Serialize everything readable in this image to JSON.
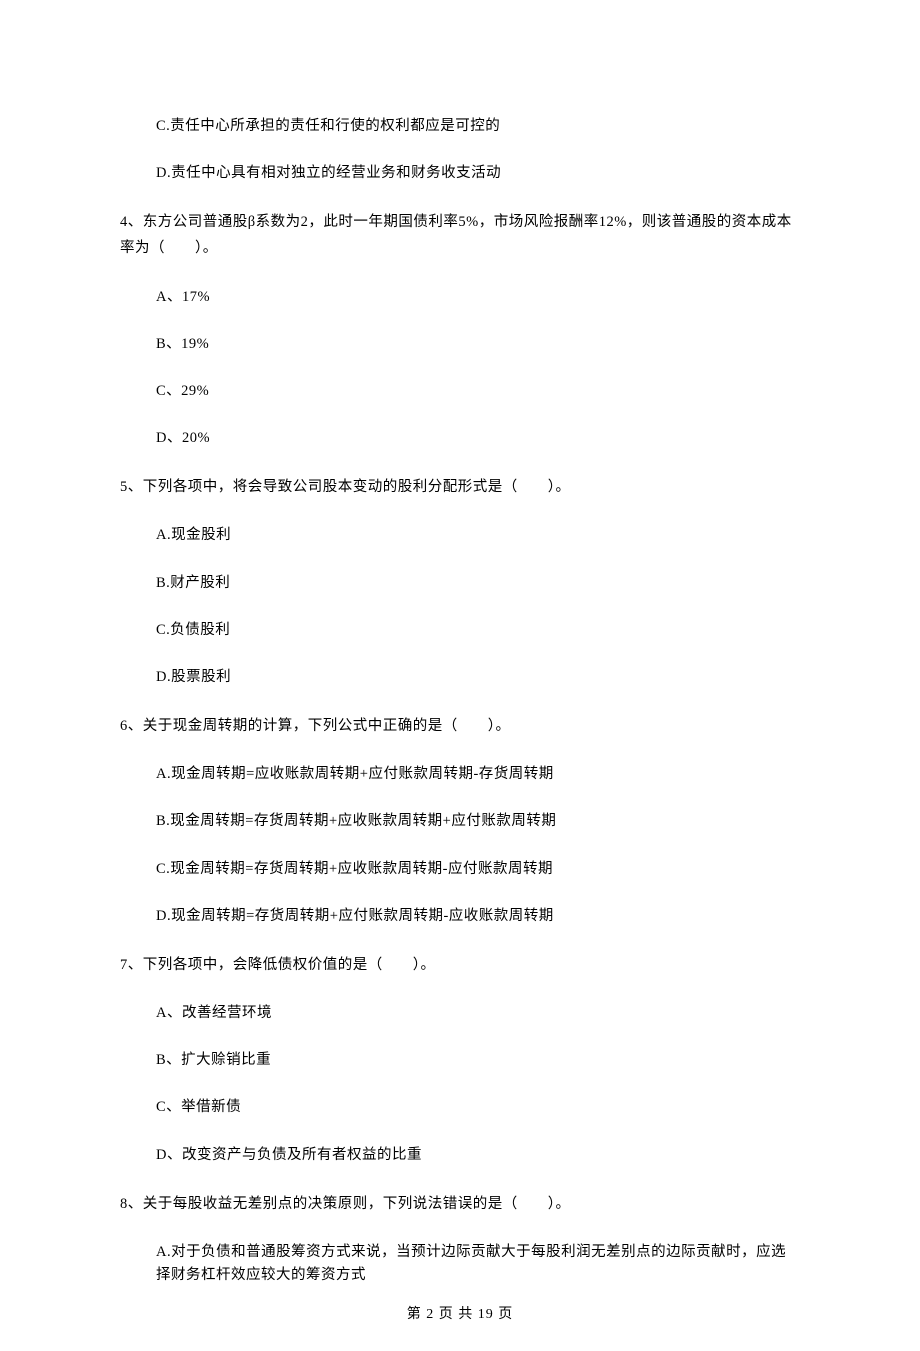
{
  "top_options": {
    "c": "C.责任中心所承担的责任和行使的权利都应是可控的",
    "d": "D.责任中心具有相对独立的经营业务和财务收支活动"
  },
  "q4": {
    "stem": "4、东方公司普通股β系数为2，此时一年期国债利率5%，市场风险报酬率12%，则该普通股的资本成本率为（　　）。",
    "a": "A、17%",
    "b": "B、19%",
    "c": "C、29%",
    "d": "D、20%"
  },
  "q5": {
    "stem": "5、下列各项中，将会导致公司股本变动的股利分配形式是（　　）。",
    "a": "A.现金股利",
    "b": "B.财产股利",
    "c": "C.负债股利",
    "d": "D.股票股利"
  },
  "q6": {
    "stem": "6、关于现金周转期的计算，下列公式中正确的是（　　）。",
    "a": "A.现金周转期=应收账款周转期+应付账款周转期-存货周转期",
    "b": "B.现金周转期=存货周转期+应收账款周转期+应付账款周转期",
    "c": "C.现金周转期=存货周转期+应收账款周转期-应付账款周转期",
    "d": "D.现金周转期=存货周转期+应付账款周转期-应收账款周转期"
  },
  "q7": {
    "stem": "7、下列各项中，会降低债权价值的是（　　）。",
    "a": "A、改善经营环境",
    "b": "B、扩大赊销比重",
    "c": "C、举借新债",
    "d": "D、改变资产与负债及所有者权益的比重"
  },
  "q8": {
    "stem": "8、关于每股收益无差别点的决策原则，下列说法错误的是（　　）。",
    "a": "A.对于负债和普通股筹资方式来说，当预计边际贡献大于每股利润无差别点的边际贡献时，应选择财务杠杆效应较大的筹资方式"
  },
  "footer": "第 2 页 共 19 页"
}
